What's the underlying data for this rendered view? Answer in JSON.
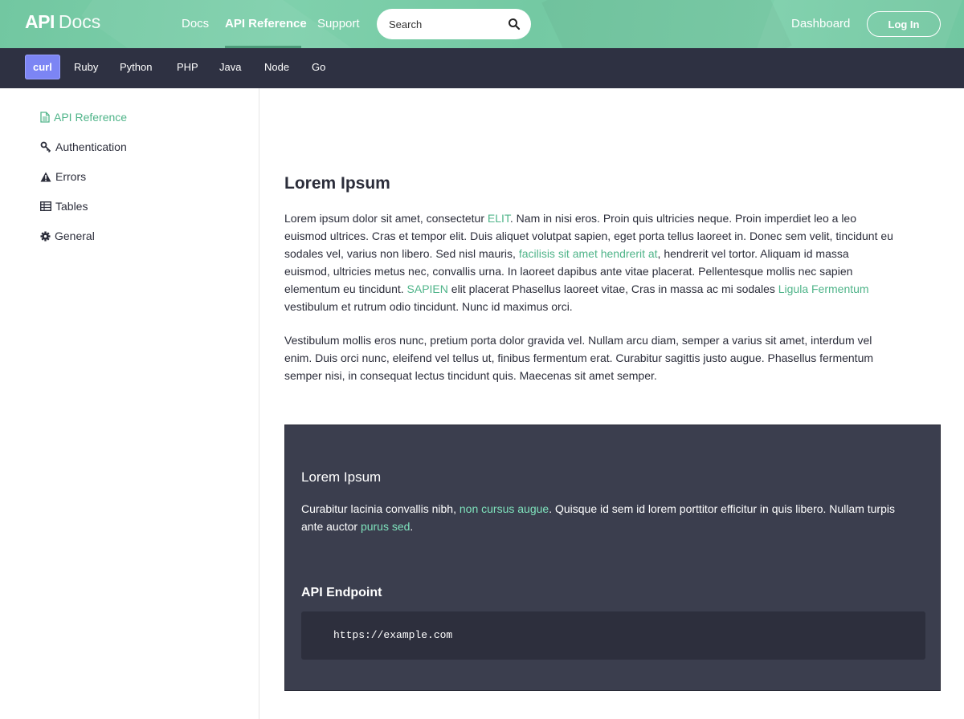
{
  "header": {
    "brand_bold": "API",
    "brand_light": "Docs",
    "nav": [
      {
        "label": "Docs",
        "active": false
      },
      {
        "label": "API Reference",
        "active": true
      },
      {
        "label": "Support",
        "active": false
      }
    ],
    "search": {
      "placeholder": "Search",
      "value": "",
      "icon": "search-icon"
    },
    "dashboard_label": "Dashboard",
    "login_label": "Log In"
  },
  "languages": [
    {
      "label": "curl",
      "active": true
    },
    {
      "label": "Ruby",
      "active": false
    },
    {
      "label": "Python",
      "active": false
    },
    {
      "label": "PHP",
      "active": false
    },
    {
      "label": "Java",
      "active": false
    },
    {
      "label": "Node",
      "active": false
    },
    {
      "label": "Go",
      "active": false
    }
  ],
  "sidebar": {
    "items": [
      {
        "label": "API Reference",
        "icon": "document-icon",
        "active": true
      },
      {
        "label": "Authentication",
        "icon": "key-icon",
        "active": false
      },
      {
        "label": "Errors",
        "icon": "warning-icon",
        "active": false
      },
      {
        "label": "Tables",
        "icon": "table-icon",
        "active": false
      },
      {
        "label": "General",
        "icon": "gear-icon",
        "active": false
      }
    ]
  },
  "main": {
    "title": "Lorem Ipsum",
    "para1": {
      "t1": "Lorem ipsum dolor sit amet, consectetur ",
      "l1": "ELIT",
      "t2": ". Nam in nisi eros. Proin quis ultricies neque. Proin imperdiet leo a leo euismod ultrices. Cras et tempor elit. Duis aliquet volutpat sapien, eget porta tellus laoreet in. Donec sem velit, tincidunt eu sodales vel, varius non libero. Sed nisl mauris, ",
      "l2": "facilisis sit amet hendrerit at",
      "t3": ", hendrerit vel tortor. Aliquam id massa euismod, ultricies metus nec, convallis urna. In laoreet dapibus ante vitae placerat. Pellentesque mollis nec sapien elementum eu tincidunt. ",
      "l3": "SAPIEN",
      "t4": " elit placerat Phasellus laoreet vitae, Cras in massa ac mi sodales ",
      "l4": "Ligula Fermentum",
      "t5": " vestibulum et rutrum odio tincidunt. Nunc id maximus orci."
    },
    "para2": "Vestibulum mollis eros nunc, pretium porta dolor gravida vel. Nullam arcu diam, semper a varius sit amet, interdum vel enim. Duis orci nunc, eleifend vel tellus ut, finibus fermentum erat. Curabitur sagittis justo augue. Phasellus fermentum semper nisi, in consequat lectus tincidunt quis. Maecenas sit amet semper."
  },
  "panel": {
    "title": "Lorem Ipsum",
    "text": {
      "t1": "Curabitur lacinia convallis nibh, ",
      "l1": "non cursus augue",
      "t2": ". Quisque id sem id lorem porttitor efficitur in quis libero. Nullam turpis ante auctor ",
      "l2": "purus sed",
      "t3": "."
    },
    "endpoint_title": "API Endpoint",
    "endpoint_url": "https://example.com"
  },
  "colors": {
    "header_green": "#74c9a3",
    "dark_bar": "#2e3142",
    "active_lang": "#7c85f4",
    "link_green": "#4fb489",
    "panel_bg": "#3b3e4e",
    "code_bg": "#2d2f3d",
    "mint_link": "#7fe3bd"
  }
}
